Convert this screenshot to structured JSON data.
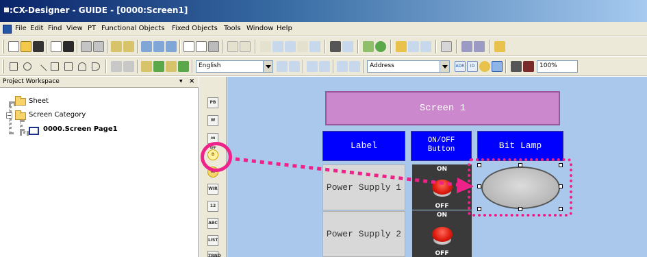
{
  "window": {
    "title": ":CX-Designer - GUIDE - [0000:Screen1]"
  },
  "menu": [
    "File",
    "Edit",
    "Find",
    "View",
    "PT",
    "Functional Objects",
    "Fixed Objects",
    "Tools",
    "Window",
    "Help"
  ],
  "toolbar": {
    "language": "English",
    "address_mode": "Address",
    "zoom": "100%",
    "address_buttons": [
      "ADR",
      "ID"
    ]
  },
  "project_workspace": {
    "title": "Project Workspace",
    "pin": "▾",
    "close": "×",
    "tree": [
      "Sheet",
      "Screen Category",
      "0000.Screen Page1"
    ]
  },
  "palette": [
    "PB",
    "W",
    "ON OFF",
    "B",
    "W",
    "WIR",
    "12",
    "ABC",
    "LIST",
    "TRND"
  ],
  "screen": {
    "banner": "Screen 1",
    "headers": {
      "label": "Label",
      "onoff": "ON/OFF\nButton",
      "bitlamp": "Bit Lamp"
    },
    "rows": [
      {
        "label": "Power Supply 1"
      },
      {
        "label": "Power Supply 2"
      }
    ],
    "switch": {
      "on_text": "ON",
      "off_text": "OFF"
    }
  },
  "colors": {
    "highlight": "#ee2288",
    "canvas": "#a9c8eb",
    "banner": "#cc88cc",
    "header": "#0000ff"
  }
}
